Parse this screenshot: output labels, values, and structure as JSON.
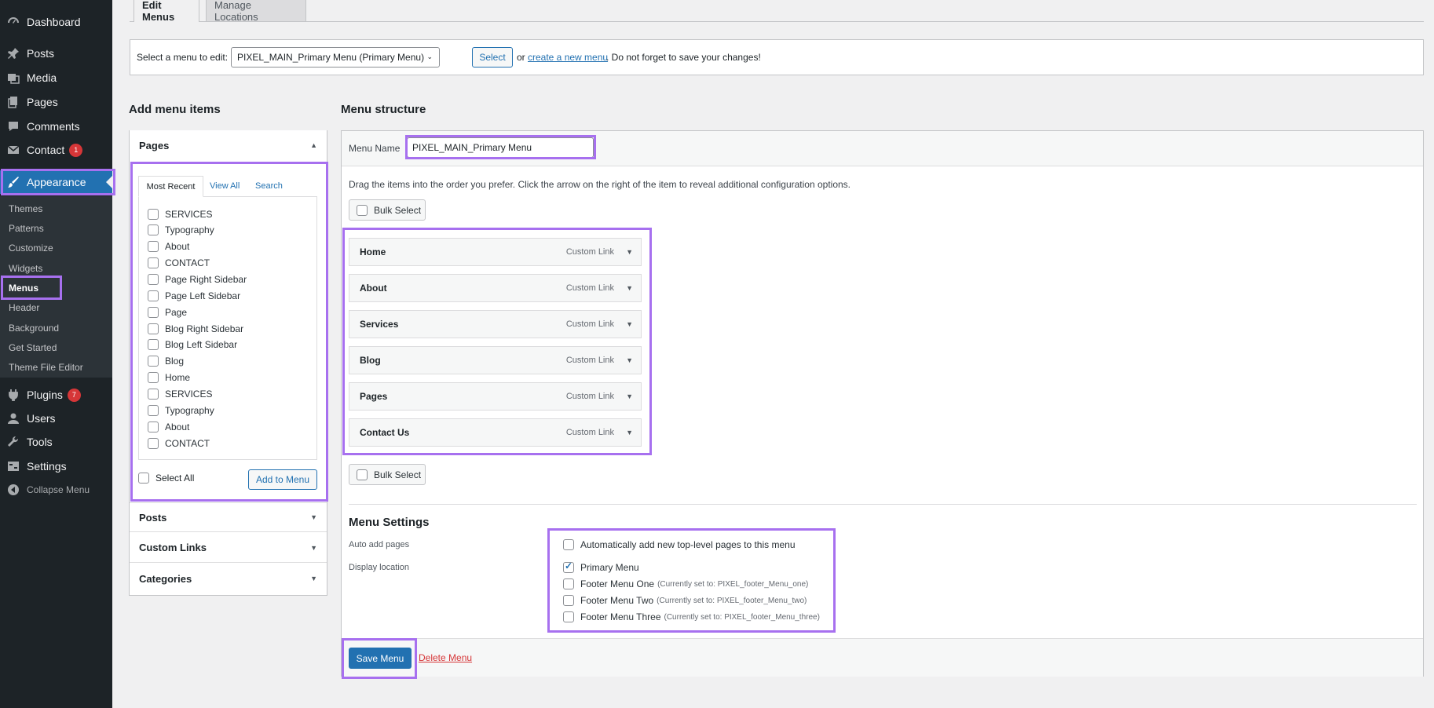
{
  "sidebar": {
    "items": [
      {
        "label": "Dashboard",
        "icon": "dashboard-icon"
      },
      {
        "label": "Posts",
        "icon": "pin-icon"
      },
      {
        "label": "Media",
        "icon": "media-icon"
      },
      {
        "label": "Pages",
        "icon": "pages-icon"
      },
      {
        "label": "Comments",
        "icon": "comment-icon"
      },
      {
        "label": "Contact",
        "icon": "mail-icon",
        "badge": "1"
      },
      {
        "label": "Appearance",
        "icon": "brush-icon"
      },
      {
        "label": "Plugins",
        "icon": "plugin-icon",
        "badge": "7"
      },
      {
        "label": "Users",
        "icon": "user-icon"
      },
      {
        "label": "Tools",
        "icon": "wrench-icon"
      },
      {
        "label": "Settings",
        "icon": "settings-icon"
      },
      {
        "label": "Collapse Menu",
        "icon": "collapse-icon"
      }
    ],
    "submenu": [
      "Themes",
      "Patterns",
      "Customize",
      "Widgets",
      "Menus",
      "Header",
      "Background",
      "Get Started",
      "Theme File Editor"
    ]
  },
  "tabs": {
    "edit": "Edit Menus",
    "manage": "Manage Locations"
  },
  "select_bar": {
    "label": "Select a menu to edit:",
    "selected": "PIXEL_MAIN_Primary Menu (Primary Menu)",
    "button": "Select",
    "or": "or",
    "link": "create a new menu",
    "tail": ". Do not forget to save your changes!"
  },
  "add_items": {
    "heading": "Add menu items",
    "pages_title": "Pages",
    "tabs": [
      "Most Recent",
      "View All",
      "Search"
    ],
    "pages": [
      "SERVICES",
      "Typography",
      "About",
      "CONTACT",
      "Page Right Sidebar",
      "Page Left Sidebar",
      "Page",
      "Blog Right Sidebar",
      "Blog Left Sidebar",
      "Blog",
      "Home",
      "SERVICES",
      "Typography",
      "About",
      "CONTACT"
    ],
    "select_all": "Select All",
    "add_button": "Add to Menu",
    "posts": "Posts",
    "custom_links": "Custom Links",
    "categories": "Categories"
  },
  "structure": {
    "heading": "Menu structure",
    "name_label": "Menu Name",
    "name_value": "PIXEL_MAIN_Primary Menu",
    "instructions": "Drag the items into the order you prefer. Click the arrow on the right of the item to reveal additional configuration options.",
    "bulk_select": "Bulk Select",
    "items": [
      {
        "title": "Home",
        "type": "Custom Link"
      },
      {
        "title": "About",
        "type": "Custom Link"
      },
      {
        "title": "Services",
        "type": "Custom Link"
      },
      {
        "title": "Blog",
        "type": "Custom Link"
      },
      {
        "title": "Pages",
        "type": "Custom Link"
      },
      {
        "title": "Contact Us",
        "type": "Custom Link"
      }
    ]
  },
  "settings": {
    "heading": "Menu Settings",
    "auto_add_label": "Auto add pages",
    "auto_add_text": "Automatically add new top-level pages to this menu",
    "display_label": "Display location",
    "locations": [
      {
        "name": "Primary Menu",
        "note": "",
        "checked": true
      },
      {
        "name": "Footer Menu One",
        "note": "(Currently set to: PIXEL_footer_Menu_one)",
        "checked": false
      },
      {
        "name": "Footer Menu Two",
        "note": "(Currently set to: PIXEL_footer_Menu_two)",
        "checked": false
      },
      {
        "name": "Footer Menu Three",
        "note": "(Currently set to: PIXEL_footer_Menu_three)",
        "checked": false
      }
    ]
  },
  "footer": {
    "save": "Save Menu",
    "delete": "Delete Menu"
  },
  "colors": {
    "accent": "#2271b1",
    "highlight": "#a770ef",
    "sidebar": "#1d2327",
    "danger": "#d63638"
  }
}
